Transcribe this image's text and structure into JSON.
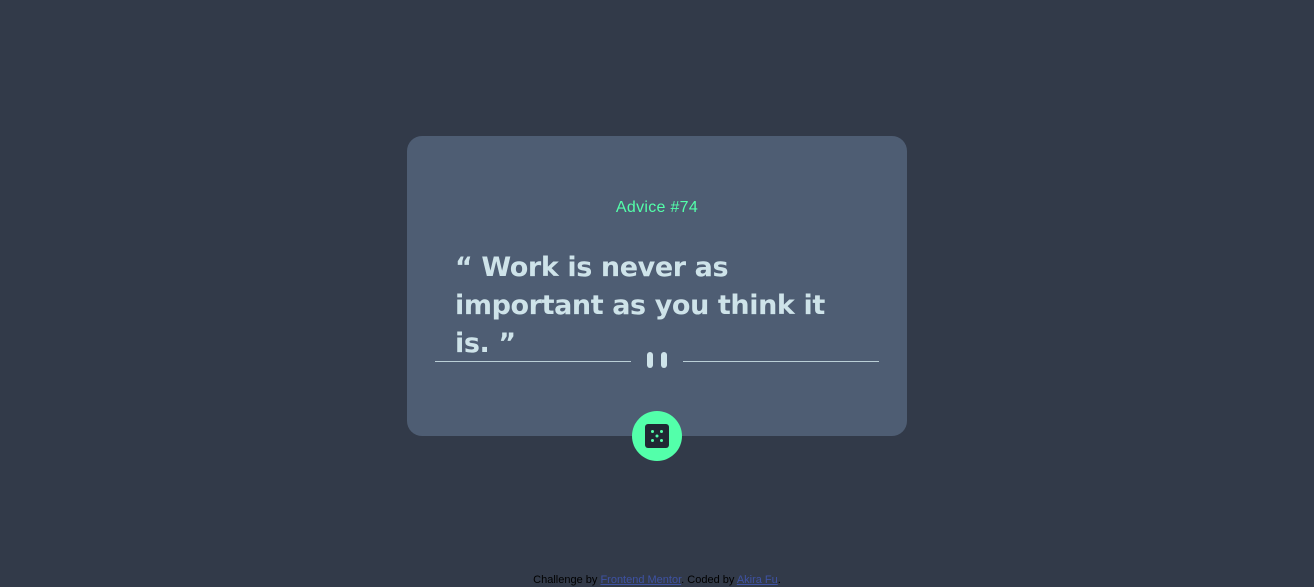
{
  "card": {
    "advice_label": "Advice #74",
    "quote": "“ Work is never as important as you think it is. ”"
  },
  "divider": {
    "icon": "pause-icon"
  },
  "dice_button": {
    "icon": "dice-icon",
    "color": "#53ffaa"
  },
  "footer": {
    "challenge_prefix": "Challenge by ",
    "challenge_link": "Frontend Mentor",
    "coded_prefix": ". Coded by ",
    "coded_link": "Akira Fu",
    "suffix": "."
  },
  "colors": {
    "background": "#323a49",
    "card": "#4e5d73",
    "accent": "#53ffaa",
    "text": "#cee3e9"
  }
}
